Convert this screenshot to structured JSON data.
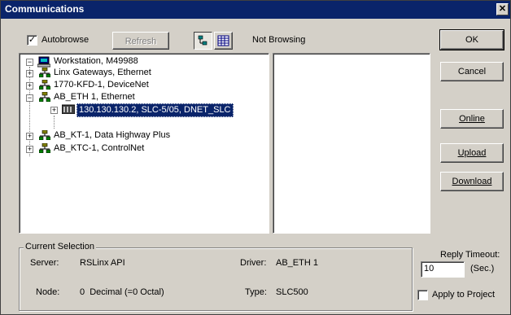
{
  "window": {
    "title": "Communications",
    "close_glyph": "✕"
  },
  "toolbar": {
    "autobrowse_label": "Autobrowse",
    "autobrowse_checked": "✓",
    "refresh_label": "Refresh",
    "status": "Not Browsing"
  },
  "tree": {
    "root": "Workstation, M49988",
    "items": [
      {
        "label": "Linx Gateways, Ethernet",
        "expander": "+"
      },
      {
        "label": "1770-KFD-1, DeviceNet",
        "expander": "+"
      },
      {
        "label": "AB_ETH 1, Ethernet",
        "expander": "−"
      },
      {
        "label": "130.130.130.2, SLC-5/05, DNET_SLC",
        "expander": "+"
      },
      {
        "label": "AB_KT-1, Data Highway Plus",
        "expander": "+"
      },
      {
        "label": "AB_KTC-1, ControlNet",
        "expander": "+"
      }
    ],
    "root_expander": "−"
  },
  "buttons": {
    "ok": "OK",
    "cancel": "Cancel",
    "online": "Online",
    "upload": "Upload",
    "download": "Download"
  },
  "current_selection": {
    "group_label": "Current Selection",
    "server_label": "Server:",
    "server_value": "RSLinx API",
    "driver_label": "Driver:",
    "driver_value": "AB_ETH 1",
    "node_label": "Node:",
    "node_value": "0  Decimal (=0 Octal)",
    "type_label": "Type:",
    "type_value": "SLC500"
  },
  "reply_timeout": {
    "label": "Reply Timeout:",
    "value": "10",
    "unit": "(Sec.)",
    "apply_label": "Apply to Project"
  },
  "colors": {
    "title_bar": "#0a246a",
    "face": "#d4d0c8",
    "selection": "#0a246a"
  }
}
